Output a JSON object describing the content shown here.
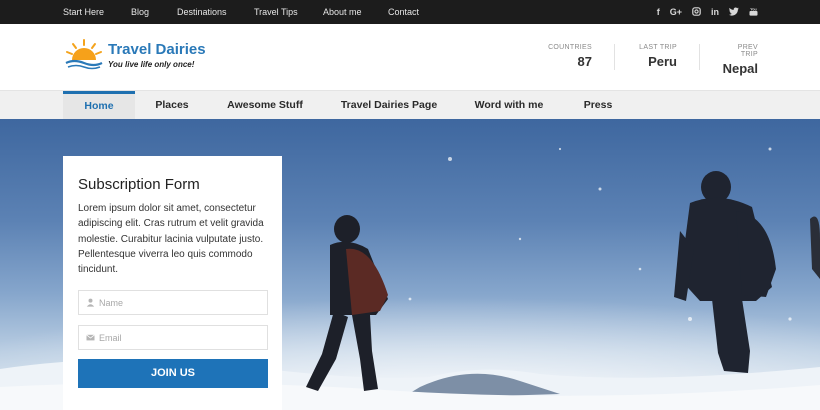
{
  "topbar": {
    "links": [
      "Start Here",
      "Blog",
      "Destinations",
      "Travel Tips",
      "About me",
      "Contact"
    ],
    "social": [
      "f",
      "G+",
      "ig",
      "in",
      "tw",
      "yt"
    ]
  },
  "logo": {
    "title": "Travel Dairies",
    "tagline": "You live life only once!"
  },
  "stats": [
    {
      "label": "COUNTRIES",
      "value": "87"
    },
    {
      "label": "LAST TRIP",
      "value": "Peru"
    },
    {
      "label": "PREV TRIP",
      "value": "Nepal"
    }
  ],
  "nav": {
    "items": [
      "Home",
      "Places",
      "Awesome Stuff",
      "Travel Dairies Page",
      "Word with me",
      "Press"
    ],
    "active": "Home"
  },
  "form": {
    "title": "Subscription Form",
    "text": "Lorem ipsum dolor sit amet, consectetur adipiscing elit. Cras rutrum et velit gravida molestie. Curabitur lacinia vulputate justo. Pellentesque viverra leo quis commodo tincidunt.",
    "name_placeholder": "Name",
    "email_placeholder": "Email",
    "button": "JOIN US"
  },
  "colors": {
    "accent": "#1e73b8",
    "topbar": "#1c1c1c",
    "nav_bg": "#f0f0f0"
  }
}
